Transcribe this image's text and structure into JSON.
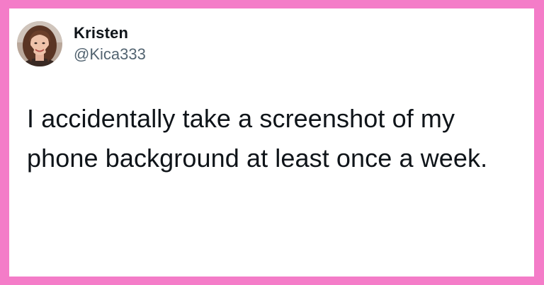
{
  "tweet": {
    "author": {
      "display_name": "Kristen",
      "handle": "@Kica333",
      "avatar_icon": "profile-photo"
    },
    "text": "I accidentally take a screenshot of my phone background at least once a week."
  },
  "colors": {
    "frame": "#f47cc8",
    "card": "#ffffff",
    "text_primary": "#0f1419",
    "text_secondary": "#536471"
  }
}
